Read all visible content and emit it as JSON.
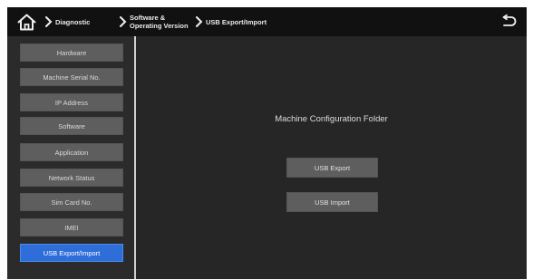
{
  "header": {
    "breadcrumb": [
      {
        "label": "Diagnostic"
      },
      {
        "label_line1": "Software &",
        "label_line2": "Operating Version"
      },
      {
        "label": "USB Export/Import"
      }
    ]
  },
  "sidebar": {
    "items": [
      {
        "label": "Hardware",
        "active": false
      },
      {
        "label": "Machine Serial No.",
        "active": false
      },
      {
        "label": "IP Address",
        "active": false
      },
      {
        "label": "Software",
        "active": false
      },
      {
        "label": "Application",
        "active": false
      },
      {
        "label": "Network Status",
        "active": false
      },
      {
        "label": "Sim Card No.",
        "active": false
      },
      {
        "label": "IMEI",
        "active": false
      },
      {
        "label": "USB Export/Import",
        "active": true
      }
    ]
  },
  "main": {
    "title": "Machine Configuration Folder",
    "export_label": "USB Export",
    "import_label": "USB Import"
  },
  "colors": {
    "accent": "#2f6ed9",
    "button": "#5e5e5e",
    "header": "#111111",
    "background": "#262626"
  },
  "icons": [
    "home-icon",
    "chevron-right-icon",
    "back-arrow-icon"
  ]
}
